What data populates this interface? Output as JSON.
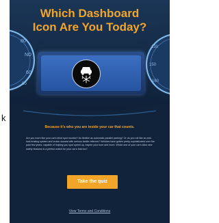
{
  "side_label": "k",
  "card": {
    "headline_line1": "Which Dashboard",
    "headline_line2": "Icon Are You Today?",
    "gauge_left_numbers": [
      "80",
      "60",
      "50"
    ],
    "gauge_left_label": "ND",
    "gauge_right_numbers": [
      "130",
      "150",
      "160"
    ],
    "icon": "traction-control-snow-icon",
    "tagline": "Because it’s who you are inside your car that counts.",
    "body_text": "Are you more like your car's blind spot monitor? As flexible as automatic parallel parking? Or do you roll like an anti-lock braking system and cruise onward with serious tactile reflexes? Vehicles have gotten pretty sophisticated over the past few years, capable of helping you spot speed up, inspire your tune and more. Which one of your car's slick new safety features is a perfect match for your car's that too?",
    "cta_label": "Take the quiz",
    "terms_label": "View Terms and Conditions"
  },
  "colors": {
    "background": "#10233b",
    "accent": "#f3a52a",
    "screen_blue": "#2f5fae",
    "gauge_ring": "#7fb8e8"
  }
}
